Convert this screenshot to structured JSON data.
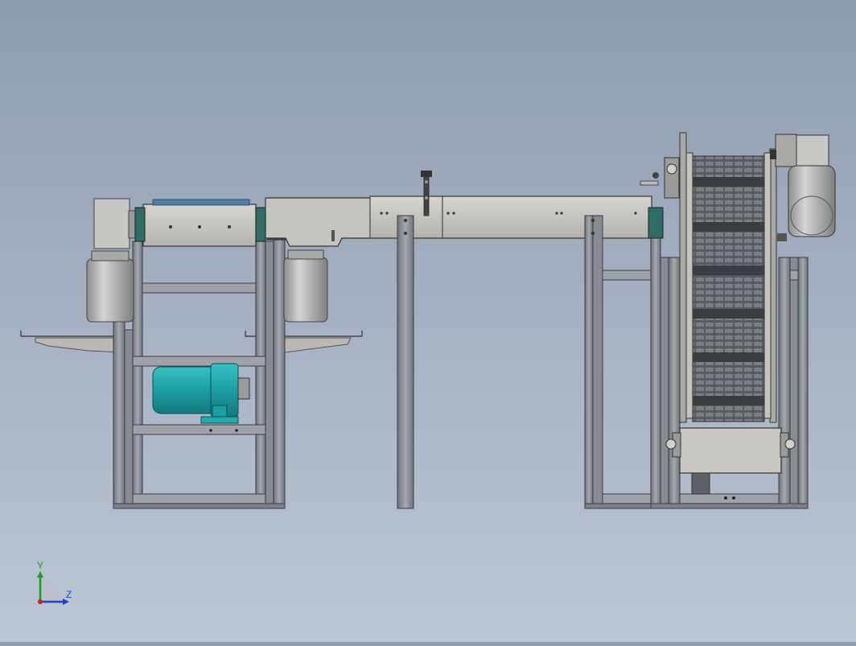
{
  "view": {
    "type": "cad-model-viewport",
    "background_top": "#8e9db1",
    "background_bottom": "#bcc6d3"
  },
  "colors": {
    "frame_steel": "#8e939a",
    "frame_dark": "#5d6168",
    "panel_light": "#c7c6c0",
    "motor_teal": "#1fa3a8",
    "belt_dark": "#3a3d42",
    "cylinder_gray": "#b5b7b6"
  },
  "axis_triad": {
    "y_label": "Y",
    "z_label": "Z",
    "y_color": "#1aa01a",
    "z_color": "#2040d0",
    "origin_color": "#d02020"
  },
  "icons": [
    "axis-triad-icon"
  ]
}
